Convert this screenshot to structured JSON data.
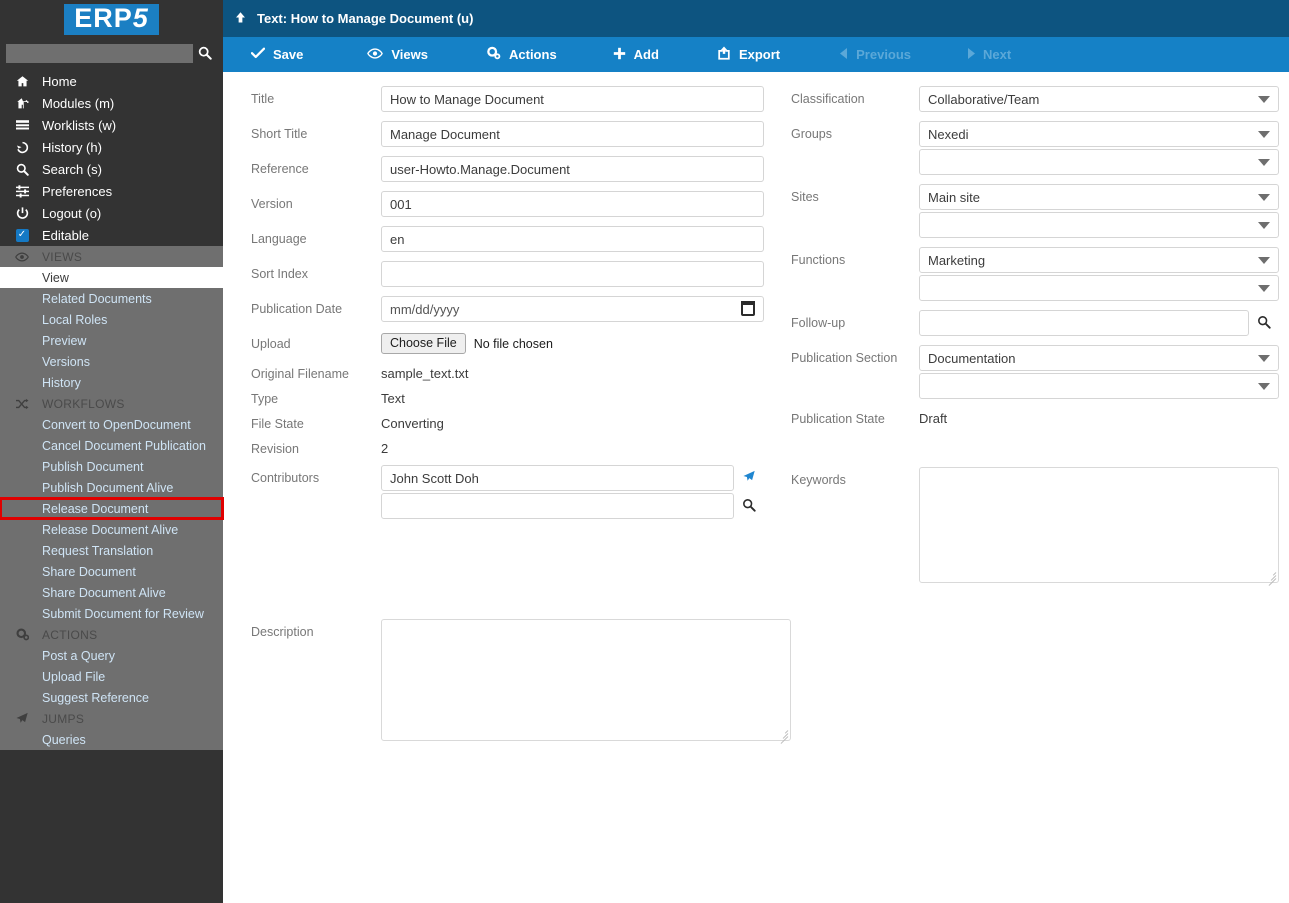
{
  "brand": {
    "logo_text_main": "ERP",
    "logo_text_accent": "5",
    "accent_color": "#1b7fc3"
  },
  "sidebar": {
    "search_placeholder": "",
    "search_value": "",
    "search_icon": "search-icon",
    "nav": [
      {
        "icon": "home-icon",
        "glyph": "⌂",
        "label": "Home"
      },
      {
        "icon": "modules-icon",
        "glyph": "⚑",
        "label": "Modules (m)"
      },
      {
        "icon": "worklists-icon",
        "glyph": "≣",
        "label": "Worklists (w)"
      },
      {
        "icon": "history-icon",
        "glyph": "↺",
        "label": "History (h)"
      },
      {
        "icon": "search-icon",
        "glyph": "⚲",
        "label": "Search (s)"
      },
      {
        "icon": "preferences-icon",
        "glyph": "☲",
        "label": "Preferences"
      },
      {
        "icon": "logout-icon",
        "glyph": "⏻",
        "label": "Logout (o)"
      },
      {
        "icon": "checkbox-icon",
        "glyph": "✓",
        "label": "Editable",
        "checked": true
      }
    ],
    "sections": [
      {
        "name": "views",
        "icon": "eye-icon",
        "glyph": "◉",
        "title": "VIEWS",
        "items": [
          {
            "label": "View",
            "state": "active"
          },
          {
            "label": "Related Documents",
            "state": "normal"
          },
          {
            "label": "Local Roles",
            "state": "normal"
          },
          {
            "label": "Preview",
            "state": "normal"
          },
          {
            "label": "Versions",
            "state": "normal"
          },
          {
            "label": "History",
            "state": "normal"
          }
        ]
      },
      {
        "name": "workflows",
        "icon": "shuffle-icon",
        "glyph": "⤨",
        "title": "WORKFLOWS",
        "items": [
          {
            "label": "Convert to OpenDocument",
            "state": "normal"
          },
          {
            "label": "Cancel Document Publication",
            "state": "normal"
          },
          {
            "label": "Publish Document",
            "state": "normal"
          },
          {
            "label": "Publish Document Alive",
            "state": "normal"
          },
          {
            "label": "Release Document",
            "state": "marked"
          },
          {
            "label": "Release Document Alive",
            "state": "normal"
          },
          {
            "label": "Request Translation",
            "state": "normal"
          },
          {
            "label": "Share Document",
            "state": "normal"
          },
          {
            "label": "Share Document Alive",
            "state": "normal"
          },
          {
            "label": "Submit Document for Review",
            "state": "normal"
          }
        ]
      },
      {
        "name": "actions",
        "icon": "gear-icon",
        "glyph": "⚙",
        "title": "ACTIONS",
        "items": [
          {
            "label": "Post a Query",
            "state": "normal"
          },
          {
            "label": "Upload File",
            "state": "normal"
          },
          {
            "label": "Suggest Reference",
            "state": "normal"
          }
        ]
      },
      {
        "name": "jumps",
        "icon": "airplane-icon",
        "glyph": "✈",
        "title": "JUMPS",
        "items": [
          {
            "label": "Queries",
            "state": "normal"
          }
        ]
      }
    ],
    "highlight_color": "#e00000"
  },
  "header": {
    "up_icon": "arrow-up-icon",
    "title": "Text: How to Manage Document (u)"
  },
  "toolbar": {
    "buttons": [
      {
        "name": "save",
        "icon": "check-icon",
        "glyph": "✔",
        "label": "Save",
        "disabled": false
      },
      {
        "name": "views",
        "icon": "eye-icon",
        "glyph": "◉",
        "label": "Views",
        "disabled": false
      },
      {
        "name": "actions",
        "icon": "gear-icon",
        "glyph": "⚙",
        "label": "Actions",
        "disabled": false
      },
      {
        "name": "add",
        "icon": "plus-icon",
        "glyph": "✚",
        "label": "Add",
        "disabled": false
      },
      {
        "name": "export",
        "icon": "export-icon",
        "glyph": "↱",
        "label": "Export",
        "disabled": false
      },
      {
        "name": "previous",
        "icon": "caret-left-icon",
        "glyph": "◀",
        "label": "Previous",
        "disabled": true
      },
      {
        "name": "next",
        "icon": "caret-right-icon",
        "glyph": "▶",
        "label": "Next",
        "disabled": true
      }
    ]
  },
  "form": {
    "left": {
      "title": {
        "label": "Title",
        "value": "How to Manage Document"
      },
      "short_title": {
        "label": "Short Title",
        "value": "Manage Document"
      },
      "reference": {
        "label": "Reference",
        "value": "user-Howto.Manage.Document"
      },
      "version": {
        "label": "Version",
        "value": "001"
      },
      "language": {
        "label": "Language",
        "value": "en"
      },
      "sort_index": {
        "label": "Sort Index",
        "value": ""
      },
      "publication_date": {
        "label": "Publication Date",
        "placeholder": "mm/dd/yyyy",
        "value": ""
      },
      "upload": {
        "label": "Upload",
        "button_label": "Choose File",
        "status": "No file chosen"
      },
      "original_filename": {
        "label": "Original Filename",
        "value": "sample_text.txt"
      },
      "type": {
        "label": "Type",
        "value": "Text"
      },
      "file_state": {
        "label": "File State",
        "value": "Converting"
      },
      "revision": {
        "label": "Revision",
        "value": "2"
      },
      "contributors": {
        "label": "Contributors",
        "value": "John Scott Doh",
        "second_value": "",
        "jump_icon": "airplane-icon",
        "search_icon": "search-icon"
      },
      "description": {
        "label": "Description",
        "value": ""
      }
    },
    "right": {
      "classification": {
        "label": "Classification",
        "value": "Collaborative/Team"
      },
      "groups": {
        "label": "Groups",
        "value": "Nexedi",
        "second_value": ""
      },
      "sites": {
        "label": "Sites",
        "value": "Main site",
        "second_value": ""
      },
      "functions": {
        "label": "Functions",
        "value": "Marketing",
        "second_value": ""
      },
      "follow_up": {
        "label": "Follow-up",
        "value": "",
        "search_icon": "search-icon"
      },
      "publication_section": {
        "label": "Publication Section",
        "value": "Documentation",
        "second_value": ""
      },
      "publication_state": {
        "label": "Publication State",
        "value": "Draft"
      },
      "keywords": {
        "label": "Keywords",
        "value": ""
      }
    }
  }
}
